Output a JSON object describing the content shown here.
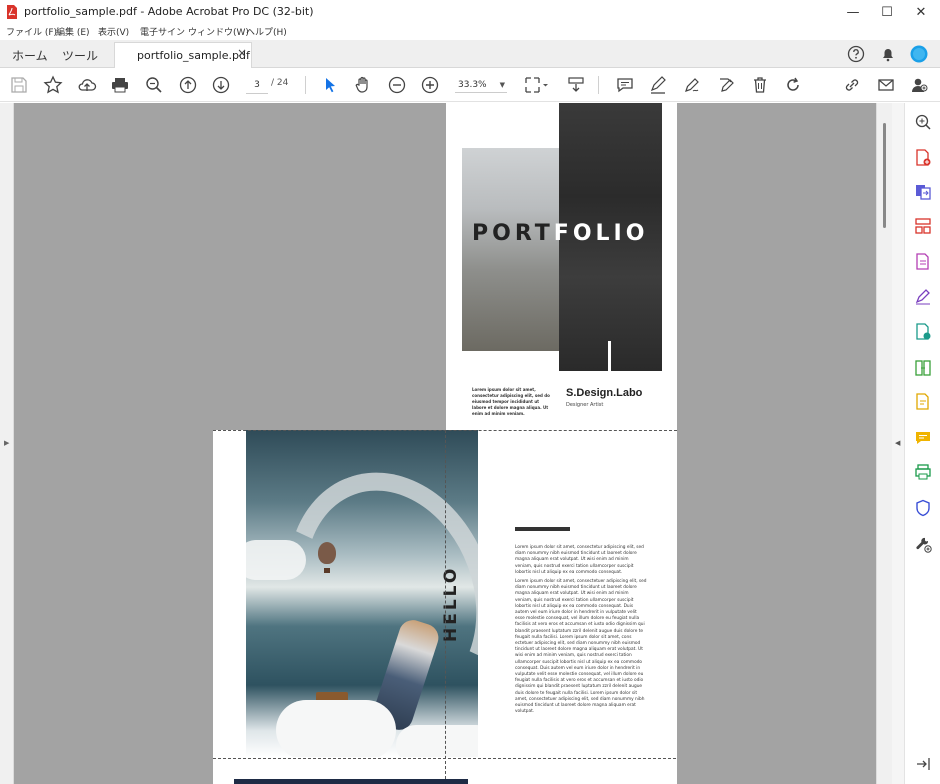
{
  "window": {
    "title": "portfolio_sample.pdf - Adobe Acrobat Pro DC (32-bit)",
    "controls": {
      "minimize": "—",
      "maximize": "☐",
      "close": "✕"
    }
  },
  "menu": [
    "ファイル (F)",
    "編集 (E)",
    "表示(V)",
    "電子サイン",
    "ウィンドウ(W)",
    "ヘルプ(H)"
  ],
  "tabs": {
    "home": "ホーム",
    "tools": "ツール",
    "document": "portfolio_sample.pdf",
    "close": "×"
  },
  "toolbar": {
    "page_current": "3",
    "page_total": "/ 24",
    "zoom": "33.3%"
  },
  "document": {
    "cover": {
      "title_dark": "PORT",
      "title_light": "FOLIO",
      "lorem": "Lorem ipsum dolor sit amet, consectetur adipiscing elit, sed do eiusmod tempor incididunt ut labore et dolore magna aliqua. Ut enim ad minim veniam.",
      "brand": "S.Design.Labo",
      "role": "Designer Artist"
    },
    "spread": {
      "heading": "HELLO",
      "paragraph1": "Lorem ipsum dolor sit amet, consectetur adipiscing elit, sed diam nonummy nibh euismod tincidunt ut laoreet dolore magna aliquam erat volutpat. Ut wisi enim ad minim veniam, quis nostrud exerci tation ullamcorper suscipit lobortis nisl ut aliquip ex ea commodo consequat.",
      "paragraph2": "Lorem ipsum dolor sit amet, consectetuer adipiscing elit, sed diam nonummy nibh euismod tincidunt ut laoreet dolore magna aliquam erat volutpat. Ut wisi enim ad minim veniam, quis nostrud exerci tation ullamcorper suscipit lobortis nisl ut aliquip ex ea commodo consequat. Duis autem vel eum iriure dolor in hendrerit in vulputate velit esse molestie consequat, vel illum dolore eu feugiat nulla facilisis at vero eros et accumsan et iusto odio dignissim qui blandit praesent luptatum zzril delenit augue duis dolore te feugait nulla facilisi. Lorem ipsum dolor sit amet, cons ectetuer adipiscing elit, sed diam nonummy nibh euismod tincidunt ut laoreet dolore magna aliquam erat volutpat. Ut wisi enim ad minim veniam, quis nostrud exerci tation ullamcorper suscipit lobortis nisl ut aliquip ex ea commodo consequat. Duis autem vel eum iriure dolor in hendrerit in vulputate velit esse molestie consequat, vel illum dolore eu feugiat nulla facilisis at vero eros et accumsan et iusto odio dignissim qui blandit praesent luptatum zzril delenit augue duis dolore te feugait nulla facilisi. Lorem ipsum dolor sit amet, consectetuer adipiscing elit, sed diam nonummy nibh euismod tincidunt ut laoreet dolore magna aliquam erat volutpat."
    }
  },
  "colors": {
    "accent": "#1473e6",
    "doc_bg": "#a3a3a3",
    "pdf_red": "#d9342b",
    "avatar": "#1aa0e8"
  }
}
